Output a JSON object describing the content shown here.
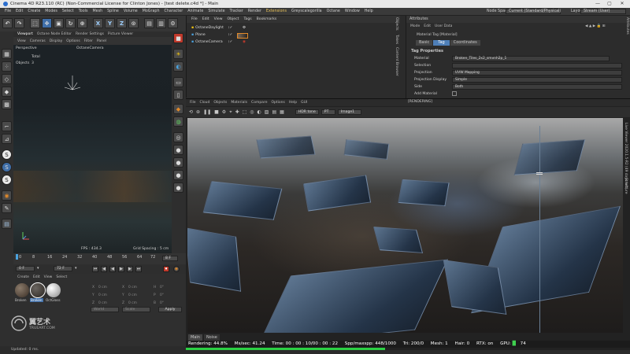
{
  "title_bar": {
    "title": "Cinema 4D R23.110 (RC) (Non-Commercial License for Clinton Jones) - [test delete.c4d *] - Main",
    "min": "—",
    "max": "▢",
    "close": "✕"
  },
  "menu": [
    "File",
    "Edit",
    "Create",
    "Modes",
    "Select",
    "Tools",
    "Mesh",
    "Spline",
    "Volume",
    "MoGraph",
    "Character",
    "Animate",
    "Simulate",
    "Tracker",
    "Render",
    "Extensions",
    "Greyscalegorilla",
    "Octane",
    "Window",
    "Help"
  ],
  "node_space": {
    "label": "Node Space:",
    "value": "Current (Standard/Physical)"
  },
  "layout": {
    "label": "Layout:",
    "value": "Stream (User)"
  },
  "toolbar": {
    "undo": "↶",
    "redo": "↷",
    "move": "✥",
    "x": "X",
    "y": "Y",
    "z": "Z"
  },
  "viewport_tabs": [
    "Viewport",
    "Octane Node Editor",
    "Render Settings",
    "Picture Viewer"
  ],
  "viewport_menu": [
    "View",
    "Cameras",
    "Display",
    "Options",
    "Filter",
    "Panel"
  ],
  "viewport": {
    "mode": "Perspective",
    "camera": "OctaneCamera",
    "stats_title": "Total",
    "objects_label": "Objects",
    "objects_value": "3",
    "fps": "FPS : 434.3",
    "grid": "Grid Spacing : 5 cm"
  },
  "timeline": {
    "ticks": [
      "0",
      "8",
      "16",
      "24",
      "32",
      "40",
      "48",
      "56",
      "64",
      "72"
    ],
    "end": "8 F",
    "start_field": "0 F",
    "end_field": "72 F"
  },
  "transport": [
    "⏮",
    "◀",
    "◀",
    "▶",
    "▶",
    "⏭",
    "⏺"
  ],
  "material_manager": {
    "menu": [
      "Create",
      "Edit",
      "View",
      "Select"
    ],
    "materials": [
      "Broken",
      "Broken",
      "OctGloss"
    ]
  },
  "coords": {
    "rows": [
      [
        "X",
        "0 cm",
        "X",
        "0 cm",
        "H",
        "0°"
      ],
      [
        "Y",
        "0 cm",
        "Y",
        "0 cm",
        "P",
        "0°"
      ],
      [
        "Z",
        "0 cm",
        "Z",
        "0 cm",
        "B",
        "0°"
      ]
    ],
    "world": "World",
    "scale": "Scale",
    "apply": "Apply"
  },
  "object_manager": {
    "menu": [
      "File",
      "Edit",
      "View",
      "Object",
      "Tags",
      "Bookmarks"
    ],
    "objects": [
      "OctaneDaylight",
      "Plane",
      "OctaneCamera"
    ],
    "side_tabs": [
      "Objects",
      "Takes",
      "Content Browser"
    ]
  },
  "attributes": {
    "header": "Attributes",
    "menu": [
      "Mode",
      "Edit",
      "User Data"
    ],
    "subtitle": "Material Tag [Material]",
    "tabs": [
      "Basic",
      "Tag",
      "Coordinates"
    ],
    "section": "Tag Properties",
    "props": [
      {
        "label": "Material",
        "value": "Broken_Tiles_2x2_smvnh2p_1"
      },
      {
        "label": "Selection",
        "value": ""
      },
      {
        "label": "Projection",
        "value": "UVW Mapping"
      },
      {
        "label": "Projection Display",
        "value": "Simple"
      },
      {
        "label": "Side",
        "value": "Both"
      },
      {
        "label": "Add Material",
        "value": ""
      }
    ],
    "side_tabs": [
      "Attributes",
      "Layers"
    ]
  },
  "octane": {
    "menu": [
      "File",
      "Cloud",
      "Objects",
      "Materials",
      "Compare",
      "Options",
      "Help",
      "GUI"
    ],
    "rendering_label": "[RENDERING]",
    "dropdowns": [
      "HDR tone",
      "PT",
      "Image1"
    ],
    "side_tabs": [
      "Live Viewer 2020.1.5-R2 (49 days left)",
      "Structure"
    ],
    "bottom_tabs": [
      "Main",
      "Noise"
    ]
  },
  "render_status": {
    "rendering": "Rendering: 44.8%",
    "ms": "Ms/sec: 41.24",
    "time": "Time: 00 : 00 : 10/00 : 00 : 22",
    "spp": "Spp/maxspp: 448/1000",
    "tri": "Tri: 200/0",
    "mesh": "Mesh: 1",
    "hair": "Hair: 0",
    "rtx": "RTX:",
    "rtx_val": "on",
    "gpu": "GPU:",
    "gpu_val": "74",
    "progress": 0.448
  },
  "status_bar": "Updated: 0 ms.",
  "watermark": {
    "cn": "翼艺术",
    "en": "TRUEART.COM"
  },
  "colors": {
    "accent_blue": "#3f6ea8",
    "progress_green": "#2bcf43",
    "tag_tab": "#4e7fb8"
  }
}
